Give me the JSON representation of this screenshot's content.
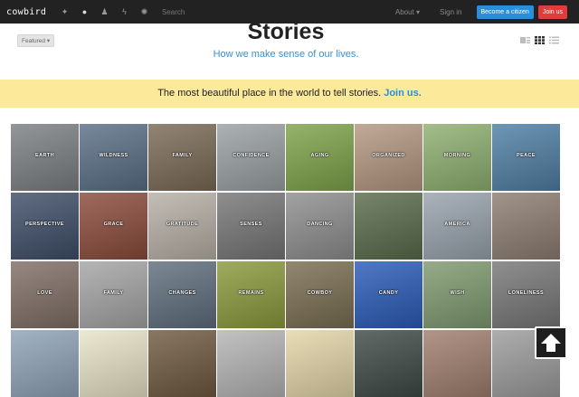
{
  "topbar": {
    "logo": "cowbird",
    "nav_icons": [
      {
        "icon": "bird-icon",
        "glyph": "✦"
      },
      {
        "icon": "speech-bubble-icon",
        "glyph": "●"
      },
      {
        "icon": "person-icon",
        "glyph": "♟"
      },
      {
        "icon": "lightning-icon",
        "glyph": "ϟ"
      },
      {
        "icon": "gear-icon",
        "glyph": "✺"
      }
    ],
    "search_label": "Search",
    "about_label": "About ▾",
    "signin_label": "Sign in",
    "citizen_button": "Become a citizen",
    "join_button": "Join us"
  },
  "header": {
    "featured_dropdown": "Featured ▾",
    "title": "Stories",
    "subtitle": "How we make sense of our lives."
  },
  "banner": {
    "text": "The most beautiful place in the world to tell stories.",
    "link": "Join us."
  },
  "tiles": [
    {
      "label": "EARTH",
      "bg": "#7c7f83"
    },
    {
      "label": "WILDNESS",
      "bg": "#5a6f86"
    },
    {
      "label": "FAMILY",
      "bg": "#7a6a55"
    },
    {
      "label": "CONFIDENCE",
      "bg": "#9aa0a2"
    },
    {
      "label": "AGING",
      "bg": "#7fa34a"
    },
    {
      "label": "ORGANIZED",
      "bg": "#b49780"
    },
    {
      "label": "MORNING",
      "bg": "#8fb070"
    },
    {
      "label": "PEACE",
      "bg": "#4f7fa4"
    },
    {
      "label": "PERSPECTIVE",
      "bg": "#3e4e68"
    },
    {
      "label": "GRACE",
      "bg": "#8b4b3b"
    },
    {
      "label": "GRATITUDE",
      "bg": "#b7b0a6"
    },
    {
      "label": "SENSES",
      "bg": "#767676"
    },
    {
      "label": "DANCING",
      "bg": "#8e8e8e"
    },
    {
      "label": "",
      "bg": "#5a6b4d"
    },
    {
      "label": "AMERICA",
      "bg": "#98a3ad"
    },
    {
      "label": "",
      "bg": "#8d7d72"
    },
    {
      "label": "LOVE",
      "bg": "#806f66"
    },
    {
      "label": "FAMILY",
      "bg": "#a5a5a5"
    },
    {
      "label": "CHANGES",
      "bg": "#5f6e7d"
    },
    {
      "label": "REMAINS",
      "bg": "#8a9a3c"
    },
    {
      "label": "COWBOY",
      "bg": "#7a6e52"
    },
    {
      "label": "CANDY",
      "bg": "#2a5cb8"
    },
    {
      "label": "WISH",
      "bg": "#7f9a6f"
    },
    {
      "label": "LONELINESS",
      "bg": "#777777"
    },
    {
      "label": "",
      "bg": "#8fa3b8"
    },
    {
      "label": "",
      "bg": "#e8e4c8"
    },
    {
      "label": "",
      "bg": "#6f5a40"
    },
    {
      "label": "",
      "bg": "#b5b5b5"
    },
    {
      "label": "",
      "bg": "#e4d6a8"
    },
    {
      "label": "",
      "bg": "#3f4a45"
    },
    {
      "label": "",
      "bg": "#a07f6e"
    },
    {
      "label": "",
      "bg": "#9c9c9c"
    }
  ],
  "colors": {
    "topbar": "#222222",
    "accent_blue": "#2a8fd8",
    "join_red": "#e23b3b",
    "banner": "#fce99a"
  }
}
